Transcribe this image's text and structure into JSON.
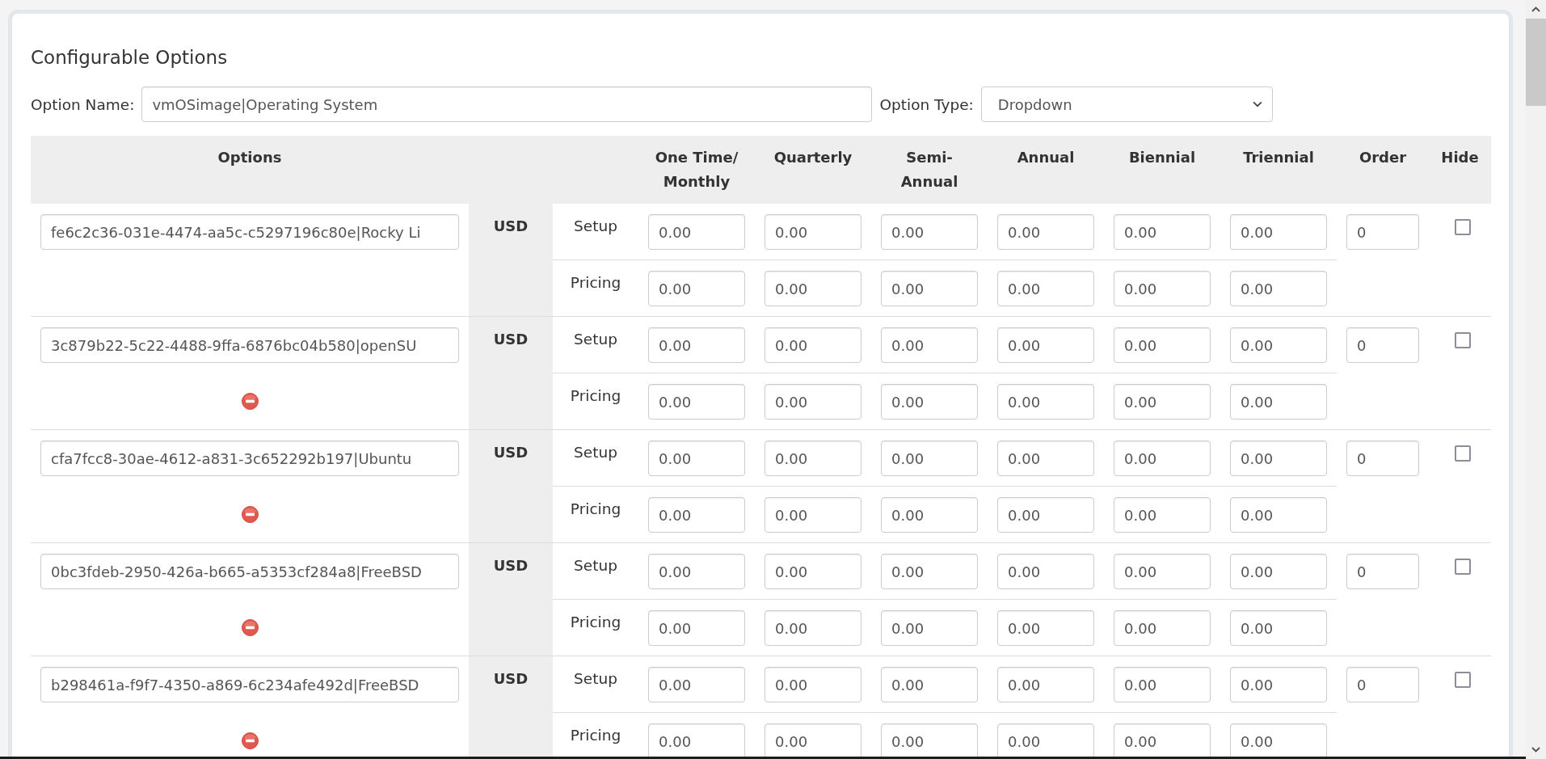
{
  "panel": {
    "title": "Configurable Options"
  },
  "option_name": {
    "label": "Option Name:",
    "value": "vmOSimage|Operating System"
  },
  "option_type": {
    "label": "Option Type:",
    "value": "Dropdown"
  },
  "table": {
    "columns": [
      "Options",
      "One Time/ Monthly",
      "Quarterly",
      "Semi-Annual",
      "Annual",
      "Biennial",
      "Triennial",
      "Order",
      "Hide"
    ],
    "rows": [
      {
        "option": "fe6c2c36-031e-4474-aa5c-c5297196c80e|Rocky Li",
        "removable": false,
        "currency": "USD",
        "pricing": [
          {
            "label": "Setup",
            "values": [
              "0.00",
              "0.00",
              "0.00",
              "0.00",
              "0.00",
              "0.00"
            ]
          },
          {
            "label": "Pricing",
            "values": [
              "0.00",
              "0.00",
              "0.00",
              "0.00",
              "0.00",
              "0.00"
            ]
          }
        ],
        "order": "0",
        "hide": false
      },
      {
        "option": "3c879b22-5c22-4488-9ffa-6876bc04b580|openSU",
        "removable": true,
        "currency": "USD",
        "pricing": [
          {
            "label": "Setup",
            "values": [
              "0.00",
              "0.00",
              "0.00",
              "0.00",
              "0.00",
              "0.00"
            ]
          },
          {
            "label": "Pricing",
            "values": [
              "0.00",
              "0.00",
              "0.00",
              "0.00",
              "0.00",
              "0.00"
            ]
          }
        ],
        "order": "0",
        "hide": false
      },
      {
        "option": "cfa7fcc8-30ae-4612-a831-3c652292b197|Ubuntu",
        "removable": true,
        "currency": "USD",
        "pricing": [
          {
            "label": "Setup",
            "values": [
              "0.00",
              "0.00",
              "0.00",
              "0.00",
              "0.00",
              "0.00"
            ]
          },
          {
            "label": "Pricing",
            "values": [
              "0.00",
              "0.00",
              "0.00",
              "0.00",
              "0.00",
              "0.00"
            ]
          }
        ],
        "order": "0",
        "hide": false
      },
      {
        "option": "0bc3fdeb-2950-426a-b665-a5353cf284a8|FreeBSD",
        "removable": true,
        "currency": "USD",
        "pricing": [
          {
            "label": "Setup",
            "values": [
              "0.00",
              "0.00",
              "0.00",
              "0.00",
              "0.00",
              "0.00"
            ]
          },
          {
            "label": "Pricing",
            "values": [
              "0.00",
              "0.00",
              "0.00",
              "0.00",
              "0.00",
              "0.00"
            ]
          }
        ],
        "order": "0",
        "hide": false
      },
      {
        "option": "b298461a-f9f7-4350-a869-6c234afe492d|FreeBSD",
        "removable": true,
        "currency": "USD",
        "pricing": [
          {
            "label": "Setup",
            "values": [
              "0.00",
              "0.00",
              "0.00",
              "0.00",
              "0.00",
              "0.00"
            ]
          },
          {
            "label": "Pricing",
            "values": [
              "0.00",
              "0.00",
              "0.00",
              "0.00",
              "0.00",
              "0.00"
            ]
          }
        ],
        "order": "0",
        "hide": false
      }
    ]
  }
}
